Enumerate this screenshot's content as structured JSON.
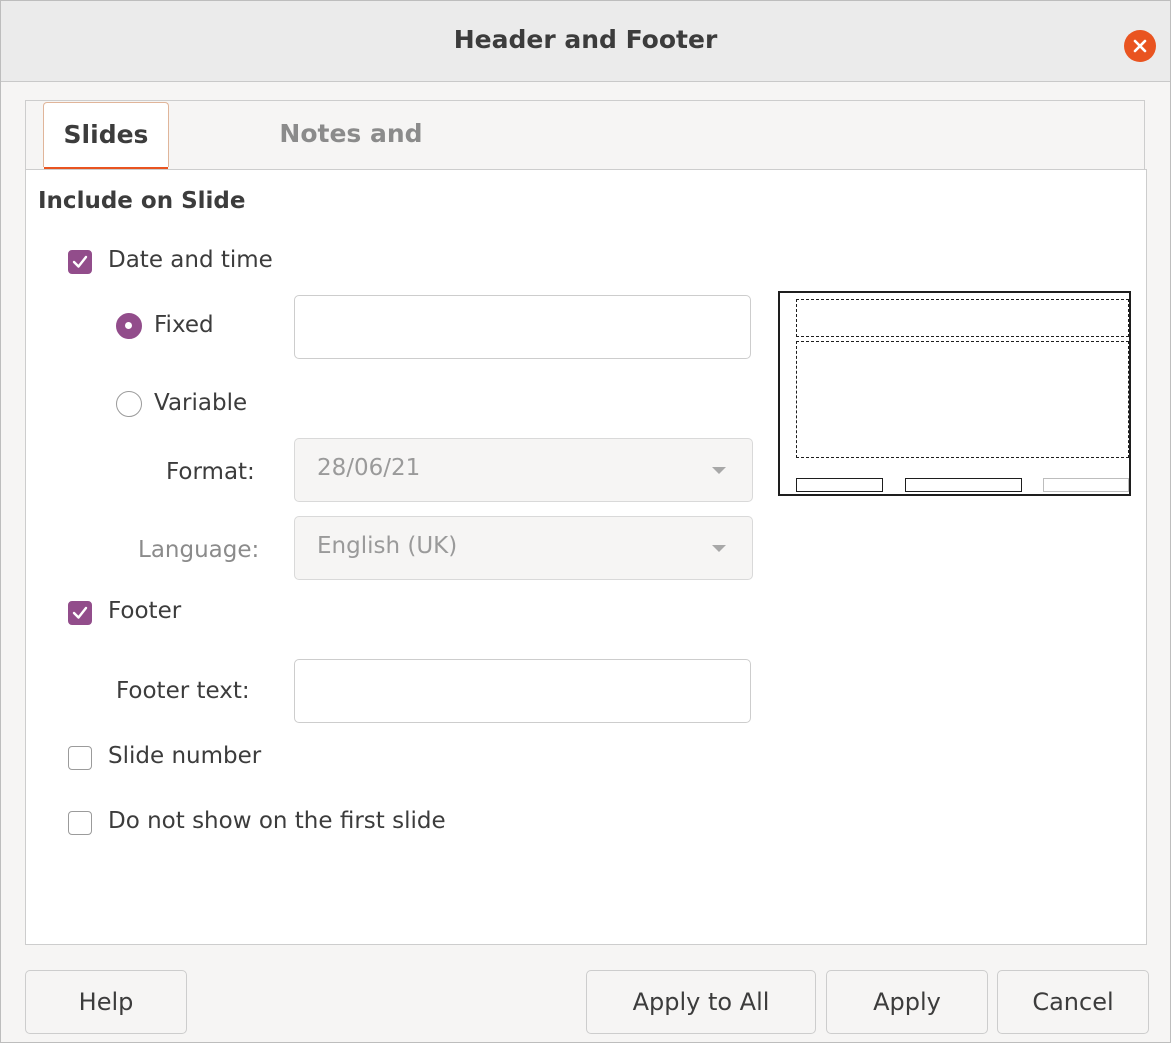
{
  "dialog": {
    "title": "Header and Footer",
    "close_icon": "close-icon"
  },
  "tabs": [
    {
      "label": "Slides",
      "active": true
    },
    {
      "label": "Notes and Handouts",
      "active": false
    }
  ],
  "panel": {
    "section_title": "Include on Slide",
    "date_time": {
      "label": "Date and time",
      "checked": true
    },
    "fixed": {
      "label": "Fixed",
      "selected": true,
      "value": ""
    },
    "variable": {
      "label": "Variable",
      "selected": false
    },
    "format": {
      "label": "Format:",
      "value": "28/06/21"
    },
    "language": {
      "label": "Language:",
      "value": "English (UK)"
    },
    "footer": {
      "label": "Footer",
      "checked": true
    },
    "footer_text": {
      "label": "Footer text:",
      "value": ""
    },
    "slide_number": {
      "label": "Slide number",
      "checked": false
    },
    "not_first": {
      "label": "Do not show on the first slide",
      "checked": false
    }
  },
  "buttons": {
    "help": "Help",
    "apply_all": "Apply to All",
    "apply": "Apply",
    "cancel": "Cancel"
  },
  "colors": {
    "accent": "#e95420",
    "check": "#924d8b"
  }
}
